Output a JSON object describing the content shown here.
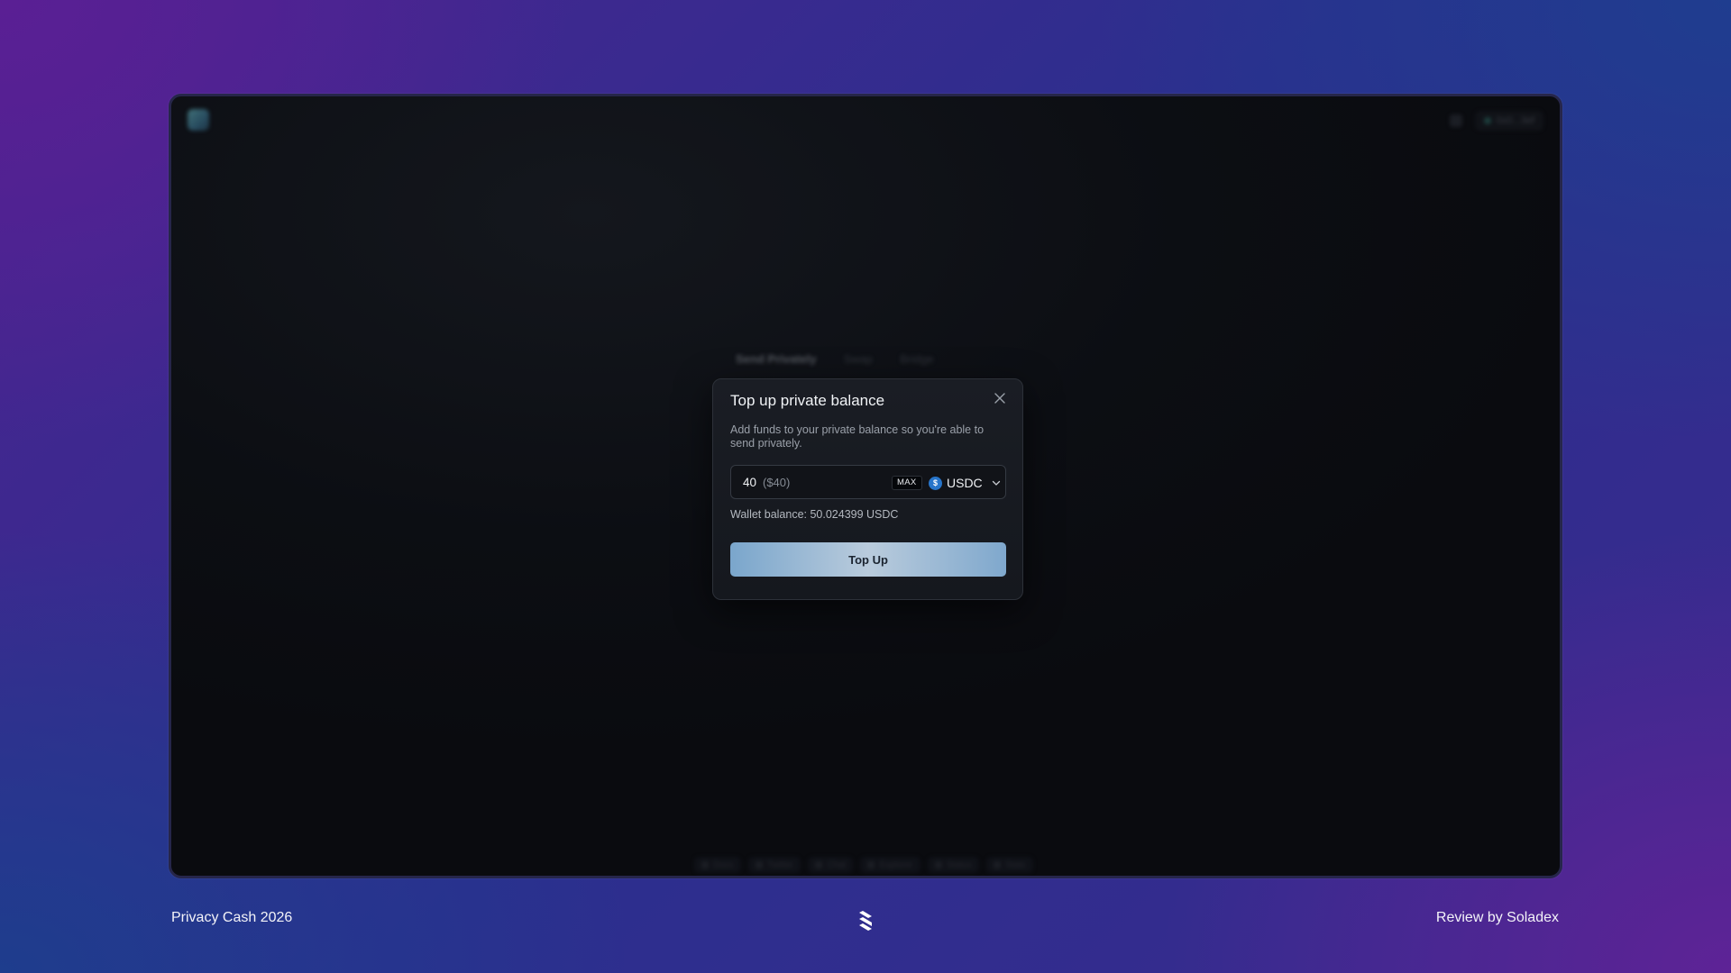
{
  "app": {
    "tabs": [
      "Send Privately",
      "Swap",
      "Bridge"
    ],
    "account_label": "0x0...3ef",
    "footer_links": [
      "Docs",
      "Twitter",
      "Chat",
      "Explorer",
      "Status",
      "Stats"
    ]
  },
  "modal": {
    "title": "Top up private balance",
    "description": "Add funds to your private balance so you're able to send privately.",
    "amount_value": "40",
    "amount_usd": "($40)",
    "max_label": "MAX",
    "token_label": "USDC",
    "wallet_balance": "Wallet balance: 50.024399 USDC",
    "submit_label": "Top Up"
  },
  "page": {
    "bottom_left": "Privacy Cash 2026",
    "bottom_right": "Review by Soladex"
  },
  "icons": {
    "close": "close-icon",
    "usdc": "usdc-icon",
    "chevron": "chevron-down-icon",
    "brand": "soladex-logo-icon"
  },
  "colors": {
    "accent": "#7aa6cc",
    "usdc": "#2775ca",
    "modal_bg": "#1a1d24"
  }
}
